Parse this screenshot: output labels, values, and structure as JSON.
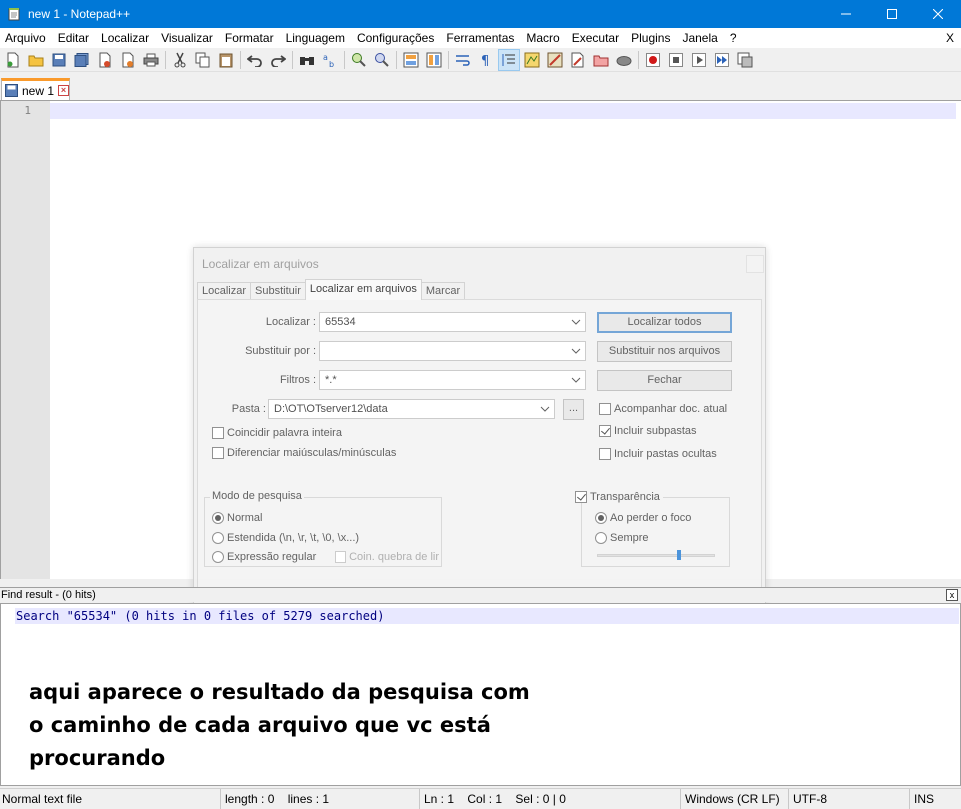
{
  "window": {
    "title": "new 1 - Notepad++"
  },
  "menu": {
    "items": [
      "Arquivo",
      "Editar",
      "Localizar",
      "Visualizar",
      "Formatar",
      "Linguagem",
      "Configurações",
      "Ferramentas",
      "Macro",
      "Executar",
      "Plugins",
      "Janela",
      "?"
    ],
    "close": "X"
  },
  "tabs": [
    {
      "label": "new 1"
    }
  ],
  "editor": {
    "line_number": "1"
  },
  "dialog": {
    "title": "Localizar em arquivos",
    "tabs": [
      "Localizar",
      "Substituir",
      "Localizar em arquivos",
      "Marcar"
    ],
    "selected_tab": "Localizar em arquivos",
    "find_label": "Localizar :",
    "find_value": "65534",
    "replace_label": "Substituir por :",
    "replace_value": "",
    "filters_label": "Filtros :",
    "filters_value": "*.*",
    "folder_label": "Pasta :",
    "folder_value": "D:\\OT\\OTserver12\\data",
    "browse_label": "...",
    "btn_find_all": "Localizar todos",
    "btn_replace_in_files": "Substituir nos arquivos",
    "btn_close": "Fechar",
    "chk_follow_doc": {
      "label": "Acompanhar doc. atual",
      "checked": false
    },
    "chk_subfolders": {
      "label": "Incluir subpastas",
      "checked": true
    },
    "chk_hidden_folders": {
      "label": "Incluir pastas ocultas",
      "checked": false
    },
    "chk_whole_word": {
      "label": "Coincidir palavra inteira",
      "checked": false
    },
    "chk_match_case": {
      "label": "Diferenciar maiúsculas/minúsculas",
      "checked": false
    },
    "search_mode": {
      "title": "Modo de pesquisa",
      "options": [
        "Normal",
        "Estendida  (\\n, \\r, \\t, \\0, \\x...)",
        "Expressão regular"
      ],
      "selected": "Normal",
      "dot_newline": "Coin. quebra de lir"
    },
    "transparency": {
      "label": "Transparência",
      "checked": true,
      "options": [
        "Ao perder o foco",
        "Sempre"
      ],
      "selected": "Ao perder o foco",
      "level": 0.7
    }
  },
  "find_result": {
    "header": "Find result - (0 hits)",
    "close": "x",
    "line": "Search \"65534\" (0 hits in 0 files of 5279 searched)"
  },
  "annotation": {
    "lines": [
      "aqui aparece o resultado da pesquisa com",
      "o caminho de cada arquivo que vc está",
      "procurando"
    ]
  },
  "statusbar": {
    "file_type": "Normal text file",
    "length": "length : 0",
    "lines": "lines : 1",
    "ln": "Ln : 1",
    "col": "Col : 1",
    "sel": "Sel : 0 | 0",
    "eol": "Windows (CR LF)",
    "encoding": "UTF-8",
    "mode": "INS"
  },
  "colors": {
    "titlebar": "#0078d7",
    "tab_accent": "#fa9a2b",
    "current_line": "#e8e8ff",
    "result_text": "#000080"
  }
}
